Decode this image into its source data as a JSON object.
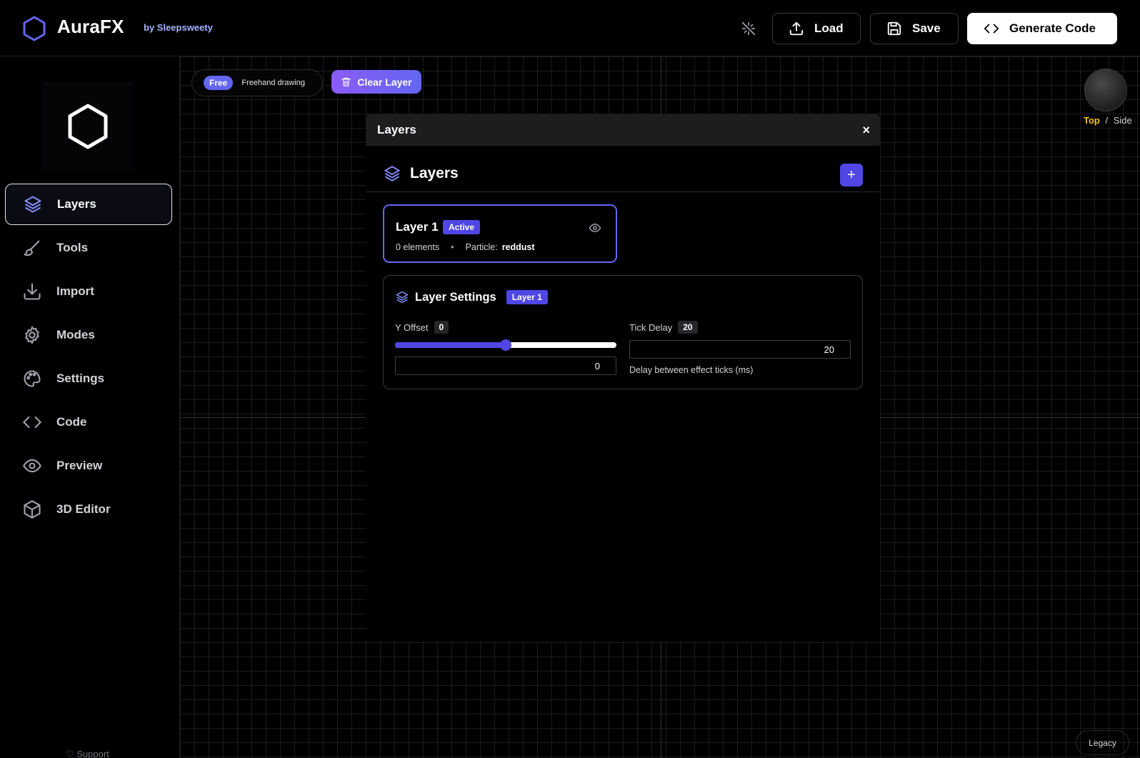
{
  "header": {
    "brand_name": "AuraFX",
    "brand_by": "by Sleepsweety",
    "load_label": "Load",
    "save_label": "Save",
    "generate_label": "Generate Code"
  },
  "sidebar": {
    "items": [
      {
        "label": "Layers",
        "icon": "layers-icon",
        "active": true
      },
      {
        "label": "Tools",
        "icon": "brush-icon"
      },
      {
        "label": "Import",
        "icon": "download-icon"
      },
      {
        "label": "Modes",
        "icon": "gear-icon"
      },
      {
        "label": "Settings",
        "icon": "palette-icon"
      },
      {
        "label": "Code",
        "icon": "code-icon"
      },
      {
        "label": "Preview",
        "icon": "eye-icon"
      },
      {
        "label": "3D Editor",
        "icon": "cube-icon"
      }
    ],
    "support_label": "♡ Support"
  },
  "toolbar": {
    "mode_badge": "Free",
    "mode_text": "Freehand drawing",
    "clear_label": "Clear Layer"
  },
  "view": {
    "top_label": "Top",
    "separator": "/",
    "side_label": "Side"
  },
  "legacy_label": "Legacy",
  "panel": {
    "window_title": "Layers",
    "close_symbol": "×",
    "header_title": "Layers",
    "add_symbol": "+",
    "layers": [
      {
        "name": "Layer 1",
        "status": "Active",
        "elements_text": "0 elements",
        "particle_label": "Particle:",
        "particle_value": "reddust"
      }
    ],
    "settings": {
      "title": "Layer Settings",
      "badge": "Layer 1",
      "y_offset": {
        "label": "Y Offset",
        "chip": "0",
        "value": "0",
        "slider_fraction": 0.5
      },
      "tick_delay": {
        "label": "Tick Delay",
        "chip": "20",
        "value": "20",
        "help": "Delay between effect ticks (ms)"
      }
    }
  },
  "colors": {
    "accent": "#4f46e5",
    "accent_light": "#6366f1",
    "view_active": "#fbbf24",
    "brand_sub": "#a5b4fc"
  }
}
